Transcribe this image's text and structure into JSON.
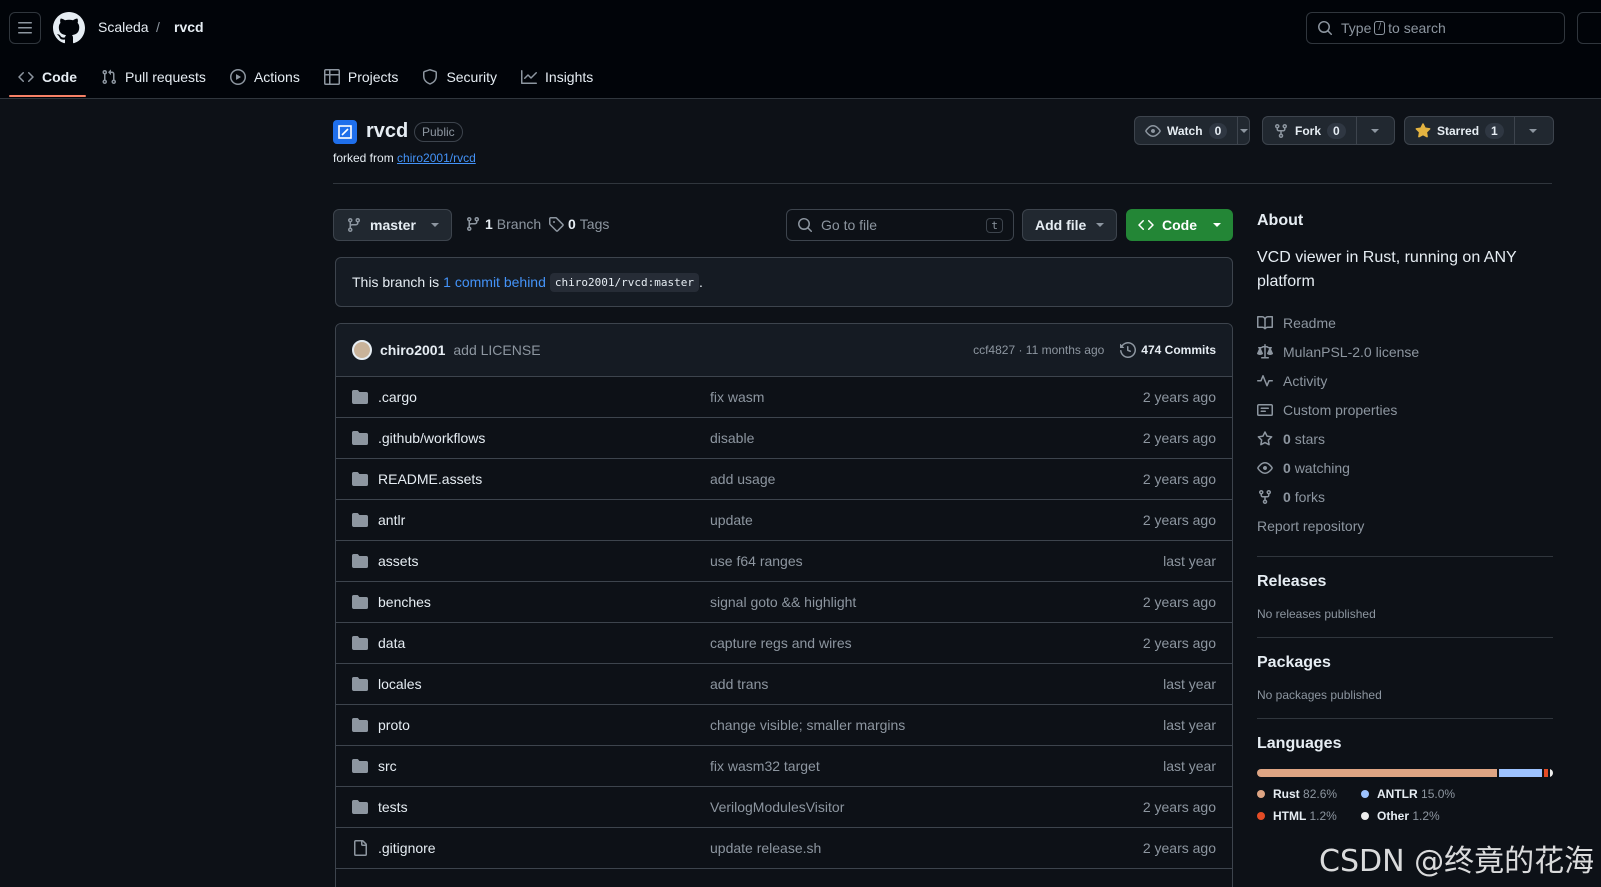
{
  "header": {
    "owner": "Scaleda",
    "separator": "/",
    "repo": "rvcd",
    "search_prefix": "Type",
    "search_key": "/",
    "search_suffix": "to search"
  },
  "tabs": [
    {
      "label": "Code",
      "icon": "code-icon"
    },
    {
      "label": "Pull requests",
      "icon": "git-pull-request-icon"
    },
    {
      "label": "Actions",
      "icon": "play-icon"
    },
    {
      "label": "Projects",
      "icon": "table-icon"
    },
    {
      "label": "Security",
      "icon": "shield-icon"
    },
    {
      "label": "Insights",
      "icon": "graph-icon"
    }
  ],
  "repo": {
    "name": "rvcd",
    "visibility": "Public",
    "forked_prefix": "forked from",
    "forked_from": "chiro2001/rvcd"
  },
  "actions": {
    "watch_label": "Watch",
    "watch_count": "0",
    "fork_label": "Fork",
    "fork_count": "0",
    "star_label": "Starred",
    "star_count": "1"
  },
  "toolbar": {
    "branch": "master",
    "branch_count": "1",
    "branch_label": "Branch",
    "tag_count": "0",
    "tag_label": "Tags",
    "goto_placeholder": "Go to file",
    "goto_key": "t",
    "add_file": "Add file",
    "code": "Code"
  },
  "behind": {
    "prefix": "This branch is",
    "link": "1 commit behind",
    "ref": "chiro2001/rvcd:master",
    "suffix": "."
  },
  "latest_commit": {
    "author": "chiro2001",
    "message": "add LICENSE",
    "sha_time": "ccf4827 · 11 months ago",
    "commits": "474 Commits"
  },
  "files": [
    {
      "type": "dir",
      "name": ".cargo",
      "message": "fix wasm",
      "date": "2 years ago"
    },
    {
      "type": "dir",
      "name": ".github/workflows",
      "message": "disable",
      "date": "2 years ago"
    },
    {
      "type": "dir",
      "name": "README.assets",
      "message": "add usage",
      "date": "2 years ago"
    },
    {
      "type": "dir",
      "name": "antlr",
      "message": "update",
      "date": "2 years ago"
    },
    {
      "type": "dir",
      "name": "assets",
      "message": "use f64 ranges",
      "date": "last year"
    },
    {
      "type": "dir",
      "name": "benches",
      "message": "signal goto && highlight",
      "date": "2 years ago"
    },
    {
      "type": "dir",
      "name": "data",
      "message": "capture regs and wires",
      "date": "2 years ago"
    },
    {
      "type": "dir",
      "name": "locales",
      "message": "add trans",
      "date": "last year"
    },
    {
      "type": "dir",
      "name": "proto",
      "message": "change visible; smaller margins",
      "date": "last year"
    },
    {
      "type": "dir",
      "name": "src",
      "message": "fix wasm32 target",
      "date": "last year"
    },
    {
      "type": "dir",
      "name": "tests",
      "message": "VerilogModulesVisitor",
      "date": "2 years ago"
    },
    {
      "type": "file",
      "name": ".gitignore",
      "message": "update release.sh",
      "date": "2 years ago"
    }
  ],
  "about": {
    "title": "About",
    "description": "VCD viewer in Rust, running on ANY platform",
    "links": [
      {
        "icon": "book-icon",
        "label": "Readme",
        "bold": ""
      },
      {
        "icon": "law-icon",
        "label": "MulanPSL-2.0 license",
        "bold": ""
      },
      {
        "icon": "pulse-icon",
        "label": "Activity",
        "bold": ""
      },
      {
        "icon": "note-icon",
        "label": "Custom properties",
        "bold": ""
      },
      {
        "icon": "star-icon",
        "label": "stars",
        "bold": "0"
      },
      {
        "icon": "eye-icon",
        "label": "watching",
        "bold": "0"
      },
      {
        "icon": "fork-icon",
        "label": "forks",
        "bold": "0"
      }
    ],
    "report": "Report repository"
  },
  "releases": {
    "title": "Releases",
    "text": "No releases published"
  },
  "packages": {
    "title": "Packages",
    "text": "No packages published"
  },
  "languages": {
    "title": "Languages",
    "items": [
      {
        "name": "Rust",
        "pct": 82.6,
        "pct_label": "82.6%",
        "color": "#dea584"
      },
      {
        "name": "ANTLR",
        "pct": 15.0,
        "pct_label": "15.0%",
        "color": "#9dc3ff"
      },
      {
        "name": "HTML",
        "pct": 1.2,
        "pct_label": "1.2%",
        "color": "#e34c26"
      },
      {
        "name": "Other",
        "pct": 1.2,
        "pct_label": "1.2%",
        "color": "#ededed"
      }
    ]
  },
  "watermark": "CSDN @终竟的花海"
}
